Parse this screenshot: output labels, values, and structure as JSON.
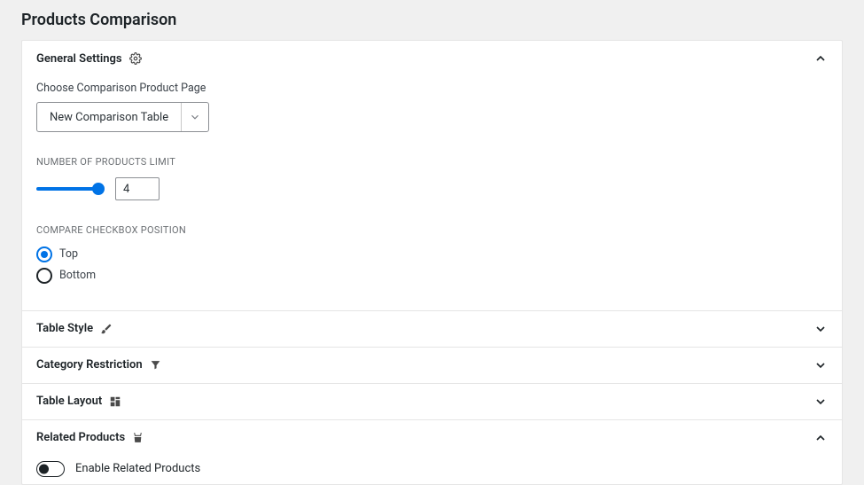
{
  "page_title": "Products Comparison",
  "general_settings": {
    "title": "General Settings",
    "choose_page_label": "Choose Comparison Product Page",
    "select_value": "New Comparison Table",
    "limit_label": "NUMBER OF PRODUCTS LIMIT",
    "limit_value": "4",
    "checkbox_pos_label": "COMPARE CHECKBOX POSITION",
    "options": {
      "top": "Top",
      "bottom": "Bottom"
    },
    "selected_position": "top"
  },
  "table_style": {
    "title": "Table Style"
  },
  "category_restriction": {
    "title": "Category Restriction"
  },
  "table_layout": {
    "title": "Table Layout"
  },
  "related_products": {
    "title": "Related Products",
    "enable_label": "Enable Related Products",
    "enabled": false
  }
}
